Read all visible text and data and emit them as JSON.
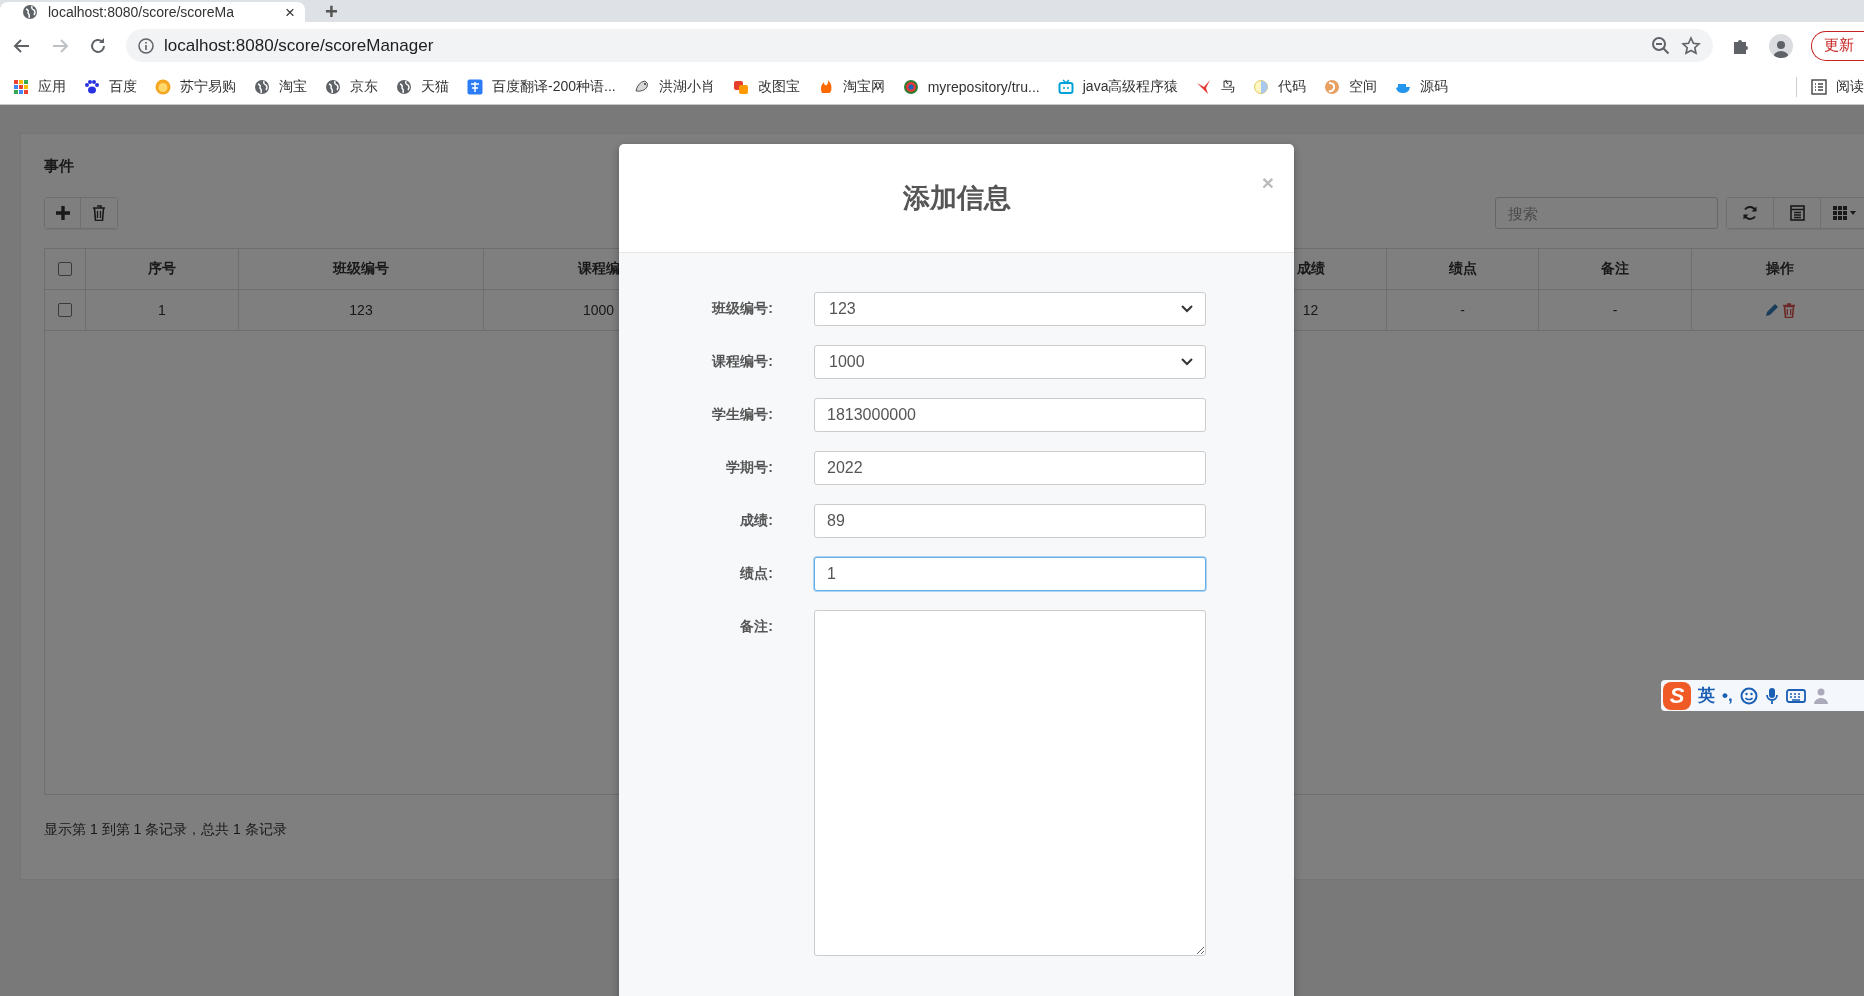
{
  "browser": {
    "tab": {
      "title": "localhost:8080/score/scoreMa",
      "close": "×"
    },
    "new_tab": "+",
    "address": "localhost:8080/score/scoreManager",
    "update_button": "更新",
    "bookmarks": [
      {
        "label": "应用"
      },
      {
        "label": "百度"
      },
      {
        "label": "苏宁易购"
      },
      {
        "label": "淘宝"
      },
      {
        "label": "京东"
      },
      {
        "label": "天猫"
      },
      {
        "label": "百度翻译-200种语..."
      },
      {
        "label": "洪湖小肖"
      },
      {
        "label": "改图宝"
      },
      {
        "label": "淘宝网"
      },
      {
        "label": "myrepository/tru..."
      },
      {
        "label": "java高级程序猿"
      },
      {
        "label": "鸟"
      },
      {
        "label": "代码"
      },
      {
        "label": "空间"
      },
      {
        "label": "源码"
      }
    ],
    "reading_list": "阅读"
  },
  "panel": {
    "title": "事件",
    "search": {
      "placeholder": "搜索"
    },
    "table": {
      "header_checked": false,
      "columns": [
        {
          "label": "序号"
        },
        {
          "label": "班级编号"
        },
        {
          "label": "课程编"
        },
        {
          "label": "成绩"
        },
        {
          "label": "绩点"
        },
        {
          "label": "备注"
        },
        {
          "label": "操作"
        }
      ],
      "rows": [
        {
          "checked": false,
          "cells": [
            "1",
            "123",
            "1000",
            "12",
            "-",
            "-"
          ]
        }
      ]
    },
    "footer": "显示第 1 到第 1 条记录，总共 1 条记录"
  },
  "dialog": {
    "title": "添加信息",
    "close": "×",
    "fields": [
      {
        "label": "班级编号:",
        "kind": "select",
        "value": "123",
        "focused": false
      },
      {
        "label": "课程编号:",
        "kind": "select",
        "value": "1000",
        "focused": false
      },
      {
        "label": "学生编号:",
        "kind": "input",
        "value": "1813000000",
        "focused": false
      },
      {
        "label": "学期号:",
        "kind": "input",
        "value": "2022",
        "focused": false
      },
      {
        "label": "成绩:",
        "kind": "input",
        "value": "89",
        "focused": false
      },
      {
        "label": "绩点:",
        "kind": "input",
        "value": "1",
        "focused": true
      },
      {
        "label": "备注:",
        "kind": "textarea",
        "focused": false
      }
    ]
  },
  "ime": {
    "logo": "S",
    "mode": "英",
    "punctuation": "•,"
  }
}
